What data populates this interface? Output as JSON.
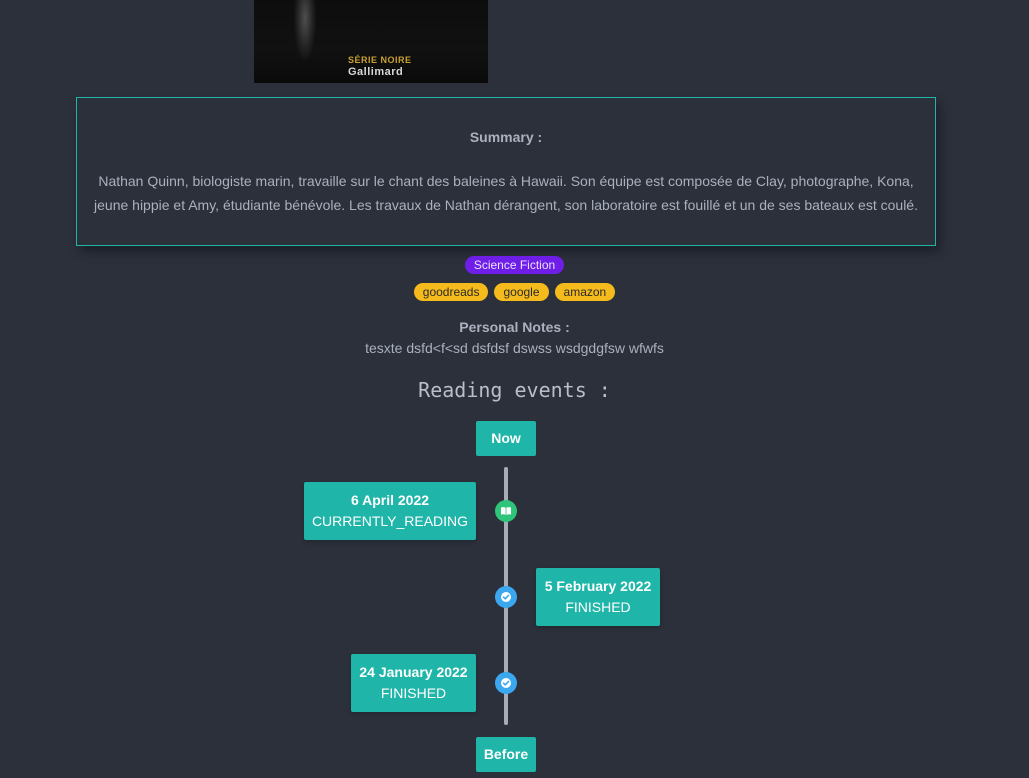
{
  "cover": {
    "serie": "SÉRIE NOIRE",
    "publisher": "Gallimard"
  },
  "summary": {
    "title": "Summary :",
    "text": "Nathan Quinn, biologiste marin, travaille sur le chant des baleines à Hawaii. Son équipe est composée de Clay, photographe, Kona, jeune hippie et Amy, étudiante bénévole. Les travaux de Nathan dérangent, son laboratoire est fouillé et un de ses bateaux est coulé."
  },
  "genres": [
    "Science Fiction"
  ],
  "links": [
    "goodreads",
    "google",
    "amazon"
  ],
  "notes": {
    "title": "Personal Notes :",
    "text": "tesxte dsfd<f<sd dsfdsf dswss wsdgdgfsw wfwfs"
  },
  "reading": {
    "title": "Reading events :",
    "now_label": "Now",
    "before_label": "Before",
    "events": [
      {
        "date": "6 April 2022",
        "status": "CURRENTLY_READING",
        "icon": "book-open-icon"
      },
      {
        "date": "5 February 2022",
        "status": "FINISHED",
        "icon": "check-circle-icon"
      },
      {
        "date": "24 January 2022",
        "status": "FINISHED",
        "icon": "check-circle-icon"
      }
    ]
  },
  "colors": {
    "accent": "#1fb5a8",
    "genre": "#6f1ee8",
    "link": "#f5bb1c",
    "reading": "#2ec47a",
    "finished": "#3aa7ee",
    "background": "#2b303b"
  }
}
